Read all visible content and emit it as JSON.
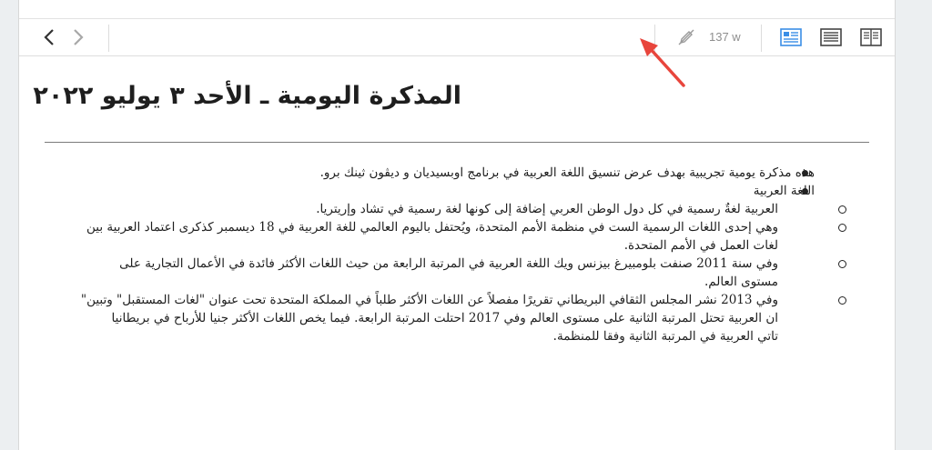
{
  "toolbar": {
    "back_icon": "chevron-left-icon",
    "forward_icon": "chevron-right-icon",
    "pen_icon": "pen-slash-icon",
    "word_count": "137 w",
    "views": [
      "reading-view-icon",
      "source-view-icon",
      "split-view-icon"
    ],
    "accent_color": "#3a8ee6"
  },
  "document": {
    "title": "المذكرة اليومية ـ الأحد ٣ يوليو ٢٠٢٢",
    "items": [
      {
        "text": "هذه مذكرة يومية تجريبية بهدف عرض تنسيق اللغة العربية في برنامج اوبسيديان و ديڤون ثينك برو."
      },
      {
        "text": "اللغة العربية",
        "children": [
          {
            "lines": [
              "العربية لغةٌ رسمية في كل دول الوطن العربي إضافة إلى كونها لغة رسمية في تشاد وإريتريا."
            ]
          },
          {
            "lines": [
              "وهي إحدى اللغات الرسمية الست في منظمة الأمم المتحدة، ويُحتفل باليوم العالمي للغة العربية في 18 ديسمبر كذكرى اعتماد العربية بين",
              "لغات العمل في الأمم المتحدة."
            ]
          },
          {
            "lines": [
              "وفي سنة 2011 صنفت بلومبيرغ بيزنس ويك اللغة العربية في المرتبة الرابعة من حيث اللغات الأكثر فائدة في الأعمال التجارية على",
              "مستوى العالم."
            ]
          },
          {
            "lines": [
              "وفي 2013 نشر المجلس الثقافي البريطاني تقريرًا مفصلاً عن اللغات الأكثر طلباً في المملكة المتحدة تحت عنوان \"لغات المستقبل\" وتبين\"",
              "ان العربية تحتل المرتبة الثانية على مستوى العالم وفي 2017 احتلت المرتبة الرابعة. فيما يخص اللغات الأكثر جنيا للأرباح في بريطانيا",
              "تاتي العربية في المرتبة الثانية وفقا للمنظمة."
            ]
          }
        ]
      }
    ]
  }
}
